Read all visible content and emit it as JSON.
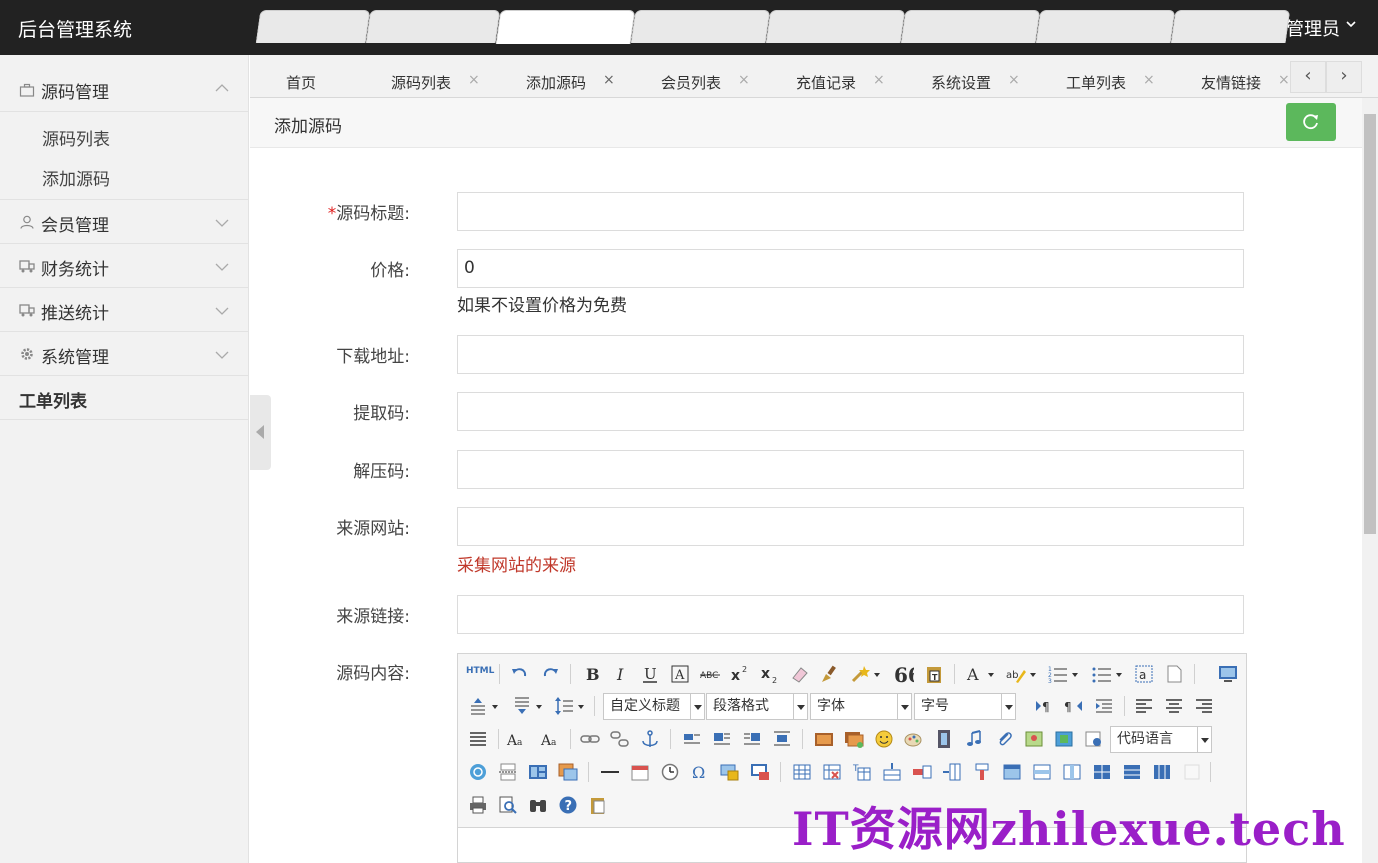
{
  "header": {
    "logo": "后台管理系统",
    "user": "超级管理员"
  },
  "sidebar": {
    "groups": [
      {
        "label": "源码管理",
        "icon": "briefcase-icon",
        "expanded": true,
        "items": [
          "源码列表",
          "添加源码"
        ]
      },
      {
        "label": "会员管理",
        "icon": "user-icon",
        "expanded": false
      },
      {
        "label": "财务统计",
        "icon": "truck-icon",
        "expanded": false
      },
      {
        "label": "推送统计",
        "icon": "truck-icon",
        "expanded": false
      },
      {
        "label": "系统管理",
        "icon": "gear-icon",
        "expanded": false
      }
    ],
    "plain_item": "工单列表"
  },
  "tabs": [
    {
      "label": "首页",
      "closable": false
    },
    {
      "label": "源码列表",
      "closable": true
    },
    {
      "label": "添加源码",
      "closable": true,
      "active": true
    },
    {
      "label": "会员列表",
      "closable": true
    },
    {
      "label": "充值记录",
      "closable": true
    },
    {
      "label": "系统设置",
      "closable": true
    },
    {
      "label": "工单列表",
      "closable": true
    },
    {
      "label": "友情链接",
      "closable": true
    }
  ],
  "tab_nav": {
    "prev": "‹",
    "next": "›"
  },
  "page": {
    "title": "添加源码"
  },
  "form": {
    "title": {
      "label": "源码标题:",
      "required_mark": "*",
      "value": ""
    },
    "price": {
      "label": "价格:",
      "value": "0",
      "hint": "如果不设置价格为免费"
    },
    "download": {
      "label": "下载地址:",
      "value": ""
    },
    "extract_code": {
      "label": "提取码:",
      "value": ""
    },
    "unzip_code": {
      "label": "解压码:",
      "value": ""
    },
    "source_site": {
      "label": "来源网站:",
      "value": "",
      "hint": "采集网站的来源"
    },
    "source_link": {
      "label": "来源链接:",
      "value": ""
    },
    "content": {
      "label": "源码内容:"
    }
  },
  "editor": {
    "html_label": "HTML",
    "selects": {
      "custom_heading": "自定义标题",
      "paragraph": "段落格式",
      "font": "字体",
      "font_size": "字号",
      "code_lang": "代码语言"
    }
  },
  "watermark": "IT资源网zhilexue.tech",
  "colors": {
    "header_bg": "#222222",
    "accent_green": "#5cb85c",
    "hint_red": "#c0392b",
    "watermark": "#9a1fc8"
  }
}
